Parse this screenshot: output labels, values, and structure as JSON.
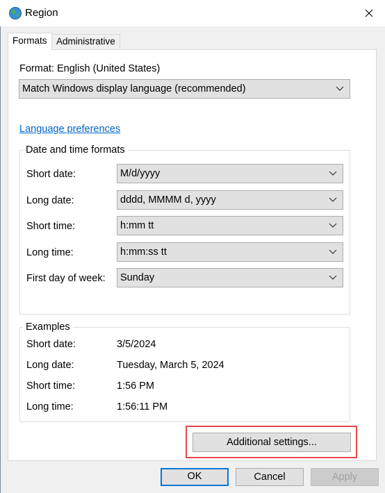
{
  "window": {
    "title": "Region",
    "icon": "globe-icon",
    "close": "close-icon"
  },
  "tabs": [
    {
      "label": "Formats",
      "active": true
    },
    {
      "label": "Administrative",
      "active": false
    }
  ],
  "format": {
    "label": "Format: English (United States)",
    "selected": "Match Windows display language (recommended)"
  },
  "language_link": "Language preferences",
  "date_time": {
    "legend": "Date and time formats",
    "rows": [
      {
        "label": "Short date:",
        "value": "M/d/yyyy"
      },
      {
        "label": "Long date:",
        "value": "dddd, MMMM d, yyyy"
      },
      {
        "label": "Short time:",
        "value": "h:mm tt"
      },
      {
        "label": "Long time:",
        "value": "h:mm:ss tt"
      },
      {
        "label": "First day of week:",
        "value": "Sunday"
      }
    ]
  },
  "examples": {
    "legend": "Examples",
    "rows": [
      {
        "label": "Short date:",
        "value": "3/5/2024"
      },
      {
        "label": "Long date:",
        "value": "Tuesday, March 5, 2024"
      },
      {
        "label": "Short time:",
        "value": "1:56 PM"
      },
      {
        "label": "Long time:",
        "value": "1:56:11 PM"
      }
    ]
  },
  "buttons": {
    "additional": "Additional settings...",
    "ok": "OK",
    "cancel": "Cancel",
    "apply": "Apply",
    "apply_enabled": false
  },
  "colors": {
    "accent": "#0078d7",
    "link": "#0066cc",
    "highlight": "#e5484d"
  }
}
